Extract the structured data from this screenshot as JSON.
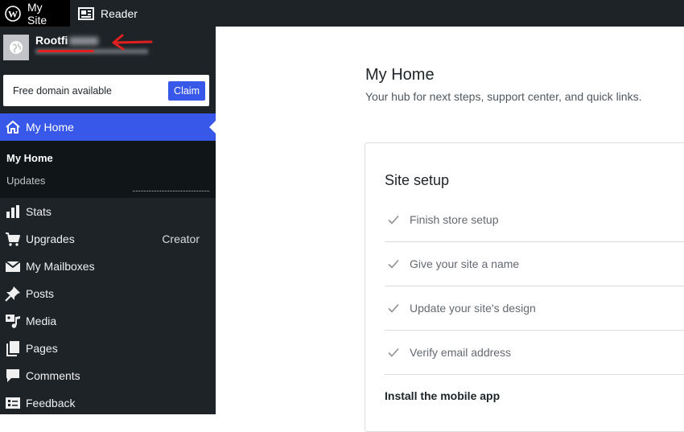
{
  "topbar": {
    "my_site_label": "My Site",
    "reader_label": "Reader"
  },
  "sidebar": {
    "site_name": "Rootfi",
    "domain_banner": {
      "text": "Free domain available",
      "claim_label": "Claim"
    },
    "active_item": {
      "label": "My Home",
      "icon": "home-icon"
    },
    "submenu": [
      {
        "label": "My Home"
      },
      {
        "label": "Updates"
      }
    ],
    "items": [
      {
        "label": "Stats",
        "icon": "stats-icon",
        "badge": ""
      },
      {
        "label": "Upgrades",
        "icon": "cart-icon",
        "badge": "Creator"
      },
      {
        "label": "My Mailboxes",
        "icon": "mail-icon",
        "badge": ""
      },
      {
        "label": "Posts",
        "icon": "pin-icon",
        "badge": ""
      },
      {
        "label": "Media",
        "icon": "media-icon",
        "badge": ""
      },
      {
        "label": "Pages",
        "icon": "pages-icon",
        "badge": ""
      },
      {
        "label": "Comments",
        "icon": "comment-icon",
        "badge": ""
      },
      {
        "label": "Feedback",
        "icon": "feedback-icon",
        "badge": ""
      }
    ]
  },
  "main": {
    "title": "My Home",
    "subtitle": "Your hub for next steps, support center, and quick links.",
    "site_setup": {
      "title": "Site setup",
      "tasks": [
        {
          "label": "Finish store setup"
        },
        {
          "label": "Give your site a name"
        },
        {
          "label": "Update your site's design"
        },
        {
          "label": "Verify email address"
        }
      ],
      "next_section": "Install the mobile app"
    }
  },
  "colors": {
    "sidebar_bg": "#1d2327",
    "accent": "#3858e9",
    "annotation": "#e02020"
  }
}
